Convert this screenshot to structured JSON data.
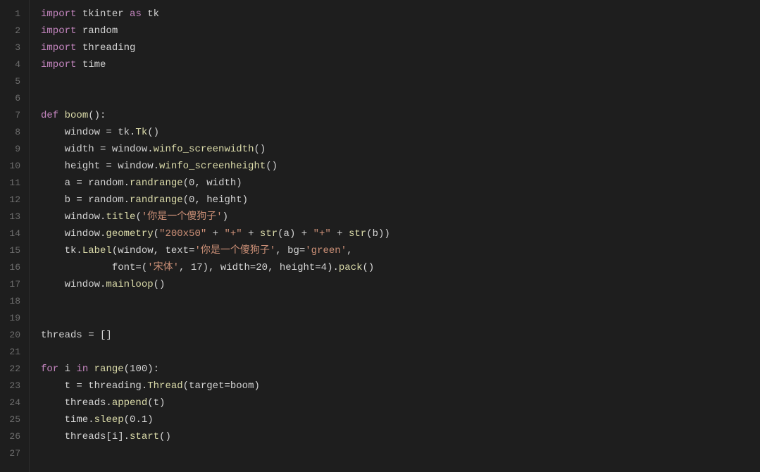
{
  "editor": {
    "background": "#1e1e1e",
    "lines": [
      {
        "num": 1,
        "tokens": [
          {
            "t": "kw",
            "v": "import"
          },
          {
            "t": "plain",
            "v": " tkinter "
          },
          {
            "t": "kw",
            "v": "as"
          },
          {
            "t": "plain",
            "v": " tk"
          }
        ]
      },
      {
        "num": 2,
        "tokens": [
          {
            "t": "kw",
            "v": "import"
          },
          {
            "t": "plain",
            "v": " random"
          }
        ]
      },
      {
        "num": 3,
        "tokens": [
          {
            "t": "kw",
            "v": "import"
          },
          {
            "t": "plain",
            "v": " threading"
          }
        ]
      },
      {
        "num": 4,
        "tokens": [
          {
            "t": "kw",
            "v": "import"
          },
          {
            "t": "plain",
            "v": " time"
          }
        ]
      },
      {
        "num": 5,
        "tokens": []
      },
      {
        "num": 6,
        "tokens": []
      },
      {
        "num": 7,
        "tokens": [
          {
            "t": "kw",
            "v": "def"
          },
          {
            "t": "plain",
            "v": " "
          },
          {
            "t": "fn",
            "v": "boom"
          },
          {
            "t": "plain",
            "v": "():"
          }
        ]
      },
      {
        "num": 8,
        "tokens": [
          {
            "t": "plain",
            "v": "    window = tk."
          },
          {
            "t": "fn",
            "v": "Tk"
          },
          {
            "t": "plain",
            "v": "()"
          }
        ]
      },
      {
        "num": 9,
        "tokens": [
          {
            "t": "plain",
            "v": "    width = window."
          },
          {
            "t": "fn",
            "v": "winfo_screenwidth"
          },
          {
            "t": "plain",
            "v": "()"
          }
        ]
      },
      {
        "num": 10,
        "tokens": [
          {
            "t": "plain",
            "v": "    height = window."
          },
          {
            "t": "fn",
            "v": "winfo_screenheight"
          },
          {
            "t": "plain",
            "v": "()"
          }
        ]
      },
      {
        "num": 11,
        "tokens": [
          {
            "t": "plain",
            "v": "    a = random."
          },
          {
            "t": "fn",
            "v": "randrange"
          },
          {
            "t": "plain",
            "v": "(0, width)"
          }
        ]
      },
      {
        "num": 12,
        "tokens": [
          {
            "t": "plain",
            "v": "    b = random."
          },
          {
            "t": "fn",
            "v": "randrange"
          },
          {
            "t": "plain",
            "v": "(0, height)"
          }
        ]
      },
      {
        "num": 13,
        "tokens": [
          {
            "t": "plain",
            "v": "    window."
          },
          {
            "t": "fn",
            "v": "title"
          },
          {
            "t": "plain",
            "v": "("
          },
          {
            "t": "str",
            "v": "'你是一个傻狗子'"
          },
          {
            "t": "plain",
            "v": ")"
          }
        ]
      },
      {
        "num": 14,
        "tokens": [
          {
            "t": "plain",
            "v": "    window."
          },
          {
            "t": "fn",
            "v": "geometry"
          },
          {
            "t": "plain",
            "v": "("
          },
          {
            "t": "str",
            "v": "\"200x50\""
          },
          {
            "t": "plain",
            "v": " + "
          },
          {
            "t": "str",
            "v": "\"<plus>\""
          },
          {
            "t": "plain",
            "v": " + "
          },
          {
            "t": "fn",
            "v": "str"
          },
          {
            "t": "plain",
            "v": "(a) + "
          },
          {
            "t": "str",
            "v": "\"<plus>\""
          },
          {
            "t": "plain",
            "v": " + "
          },
          {
            "t": "fn",
            "v": "str"
          },
          {
            "t": "plain",
            "v": "(b))"
          }
        ]
      },
      {
        "num": 15,
        "tokens": [
          {
            "t": "plain",
            "v": "    tk."
          },
          {
            "t": "fn",
            "v": "Label"
          },
          {
            "t": "plain",
            "v": "(window, text="
          },
          {
            "t": "str",
            "v": "'你是一个傻狗子'"
          },
          {
            "t": "plain",
            "v": ", bg="
          },
          {
            "t": "str",
            "v": "'green'"
          },
          {
            "t": "plain",
            "v": ","
          }
        ]
      },
      {
        "num": 16,
        "tokens": [
          {
            "t": "plain",
            "v": "            font=("
          },
          {
            "t": "str",
            "v": "'宋体'"
          },
          {
            "t": "plain",
            "v": ", 17), width=20, height=4)."
          },
          {
            "t": "fn",
            "v": "pack"
          },
          {
            "t": "plain",
            "v": "()"
          }
        ]
      },
      {
        "num": 17,
        "tokens": [
          {
            "t": "plain",
            "v": "    window."
          },
          {
            "t": "fn",
            "v": "mainloop"
          },
          {
            "t": "plain",
            "v": "()"
          }
        ]
      },
      {
        "num": 18,
        "tokens": []
      },
      {
        "num": 19,
        "tokens": []
      },
      {
        "num": 20,
        "tokens": [
          {
            "t": "plain",
            "v": "threads = []"
          }
        ]
      },
      {
        "num": 21,
        "tokens": []
      },
      {
        "num": 22,
        "tokens": [
          {
            "t": "kw",
            "v": "for"
          },
          {
            "t": "plain",
            "v": " i "
          },
          {
            "t": "kw",
            "v": "in"
          },
          {
            "t": "plain",
            "v": " "
          },
          {
            "t": "fn",
            "v": "range"
          },
          {
            "t": "plain",
            "v": "(100):"
          }
        ]
      },
      {
        "num": 23,
        "tokens": [
          {
            "t": "plain",
            "v": "    t = threading."
          },
          {
            "t": "fn",
            "v": "Thread"
          },
          {
            "t": "plain",
            "v": "(target=boom)"
          }
        ]
      },
      {
        "num": 24,
        "tokens": [
          {
            "t": "plain",
            "v": "    threads."
          },
          {
            "t": "fn",
            "v": "append"
          },
          {
            "t": "plain",
            "v": "(t)"
          }
        ]
      },
      {
        "num": 25,
        "tokens": [
          {
            "t": "plain",
            "v": "    time."
          },
          {
            "t": "fn",
            "v": "sleep"
          },
          {
            "t": "plain",
            "v": "(0.1)"
          }
        ]
      },
      {
        "num": 26,
        "tokens": [
          {
            "t": "plain",
            "v": "    threads[i]."
          },
          {
            "t": "fn",
            "v": "start"
          },
          {
            "t": "plain",
            "v": "()"
          }
        ]
      },
      {
        "num": 27,
        "tokens": []
      }
    ]
  }
}
